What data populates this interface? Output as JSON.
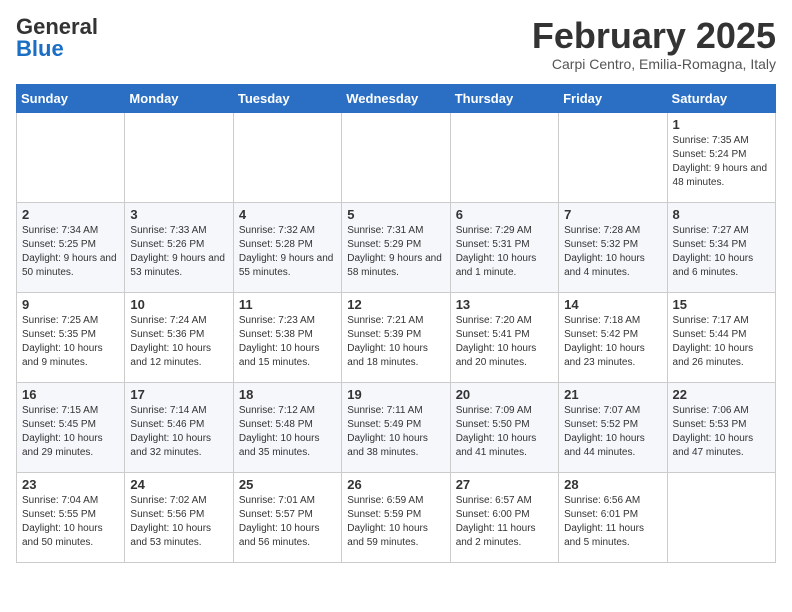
{
  "header": {
    "logo_general": "General",
    "logo_blue": "Blue",
    "month_title": "February 2025",
    "location": "Carpi Centro, Emilia-Romagna, Italy"
  },
  "days_of_week": [
    "Sunday",
    "Monday",
    "Tuesday",
    "Wednesday",
    "Thursday",
    "Friday",
    "Saturday"
  ],
  "weeks": [
    [
      {
        "day": "",
        "info": ""
      },
      {
        "day": "",
        "info": ""
      },
      {
        "day": "",
        "info": ""
      },
      {
        "day": "",
        "info": ""
      },
      {
        "day": "",
        "info": ""
      },
      {
        "day": "",
        "info": ""
      },
      {
        "day": "1",
        "info": "Sunrise: 7:35 AM\nSunset: 5:24 PM\nDaylight: 9 hours and 48 minutes."
      }
    ],
    [
      {
        "day": "2",
        "info": "Sunrise: 7:34 AM\nSunset: 5:25 PM\nDaylight: 9 hours and 50 minutes."
      },
      {
        "day": "3",
        "info": "Sunrise: 7:33 AM\nSunset: 5:26 PM\nDaylight: 9 hours and 53 minutes."
      },
      {
        "day": "4",
        "info": "Sunrise: 7:32 AM\nSunset: 5:28 PM\nDaylight: 9 hours and 55 minutes."
      },
      {
        "day": "5",
        "info": "Sunrise: 7:31 AM\nSunset: 5:29 PM\nDaylight: 9 hours and 58 minutes."
      },
      {
        "day": "6",
        "info": "Sunrise: 7:29 AM\nSunset: 5:31 PM\nDaylight: 10 hours and 1 minute."
      },
      {
        "day": "7",
        "info": "Sunrise: 7:28 AM\nSunset: 5:32 PM\nDaylight: 10 hours and 4 minutes."
      },
      {
        "day": "8",
        "info": "Sunrise: 7:27 AM\nSunset: 5:34 PM\nDaylight: 10 hours and 6 minutes."
      }
    ],
    [
      {
        "day": "9",
        "info": "Sunrise: 7:25 AM\nSunset: 5:35 PM\nDaylight: 10 hours and 9 minutes."
      },
      {
        "day": "10",
        "info": "Sunrise: 7:24 AM\nSunset: 5:36 PM\nDaylight: 10 hours and 12 minutes."
      },
      {
        "day": "11",
        "info": "Sunrise: 7:23 AM\nSunset: 5:38 PM\nDaylight: 10 hours and 15 minutes."
      },
      {
        "day": "12",
        "info": "Sunrise: 7:21 AM\nSunset: 5:39 PM\nDaylight: 10 hours and 18 minutes."
      },
      {
        "day": "13",
        "info": "Sunrise: 7:20 AM\nSunset: 5:41 PM\nDaylight: 10 hours and 20 minutes."
      },
      {
        "day": "14",
        "info": "Sunrise: 7:18 AM\nSunset: 5:42 PM\nDaylight: 10 hours and 23 minutes."
      },
      {
        "day": "15",
        "info": "Sunrise: 7:17 AM\nSunset: 5:44 PM\nDaylight: 10 hours and 26 minutes."
      }
    ],
    [
      {
        "day": "16",
        "info": "Sunrise: 7:15 AM\nSunset: 5:45 PM\nDaylight: 10 hours and 29 minutes."
      },
      {
        "day": "17",
        "info": "Sunrise: 7:14 AM\nSunset: 5:46 PM\nDaylight: 10 hours and 32 minutes."
      },
      {
        "day": "18",
        "info": "Sunrise: 7:12 AM\nSunset: 5:48 PM\nDaylight: 10 hours and 35 minutes."
      },
      {
        "day": "19",
        "info": "Sunrise: 7:11 AM\nSunset: 5:49 PM\nDaylight: 10 hours and 38 minutes."
      },
      {
        "day": "20",
        "info": "Sunrise: 7:09 AM\nSunset: 5:50 PM\nDaylight: 10 hours and 41 minutes."
      },
      {
        "day": "21",
        "info": "Sunrise: 7:07 AM\nSunset: 5:52 PM\nDaylight: 10 hours and 44 minutes."
      },
      {
        "day": "22",
        "info": "Sunrise: 7:06 AM\nSunset: 5:53 PM\nDaylight: 10 hours and 47 minutes."
      }
    ],
    [
      {
        "day": "23",
        "info": "Sunrise: 7:04 AM\nSunset: 5:55 PM\nDaylight: 10 hours and 50 minutes."
      },
      {
        "day": "24",
        "info": "Sunrise: 7:02 AM\nSunset: 5:56 PM\nDaylight: 10 hours and 53 minutes."
      },
      {
        "day": "25",
        "info": "Sunrise: 7:01 AM\nSunset: 5:57 PM\nDaylight: 10 hours and 56 minutes."
      },
      {
        "day": "26",
        "info": "Sunrise: 6:59 AM\nSunset: 5:59 PM\nDaylight: 10 hours and 59 minutes."
      },
      {
        "day": "27",
        "info": "Sunrise: 6:57 AM\nSunset: 6:00 PM\nDaylight: 11 hours and 2 minutes."
      },
      {
        "day": "28",
        "info": "Sunrise: 6:56 AM\nSunset: 6:01 PM\nDaylight: 11 hours and 5 minutes."
      },
      {
        "day": "",
        "info": ""
      }
    ]
  ]
}
